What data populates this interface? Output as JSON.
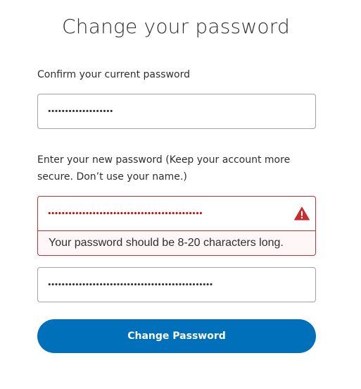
{
  "title": "Change your password",
  "current_password": {
    "label": "Confirm your current password",
    "value": "•••••••••••••••••••"
  },
  "new_password": {
    "label": "Enter your new password (Keep your account more secure. Don’t use your name.)",
    "value": "•••••••••••••••••••••••••••••••••••••••••••••",
    "error_message": "Your password should be 8-20 characters long.",
    "status_icon": "warning-triangle-icon"
  },
  "confirm_password": {
    "value": "••••••••••••••••••••••••••••••••••••••••••••••••"
  },
  "submit_label": "Change Password",
  "colors": {
    "primary": "#0070ba",
    "error": "#c72e2e",
    "error_bg": "#fff7f7",
    "error_dots": "#d20000"
  }
}
